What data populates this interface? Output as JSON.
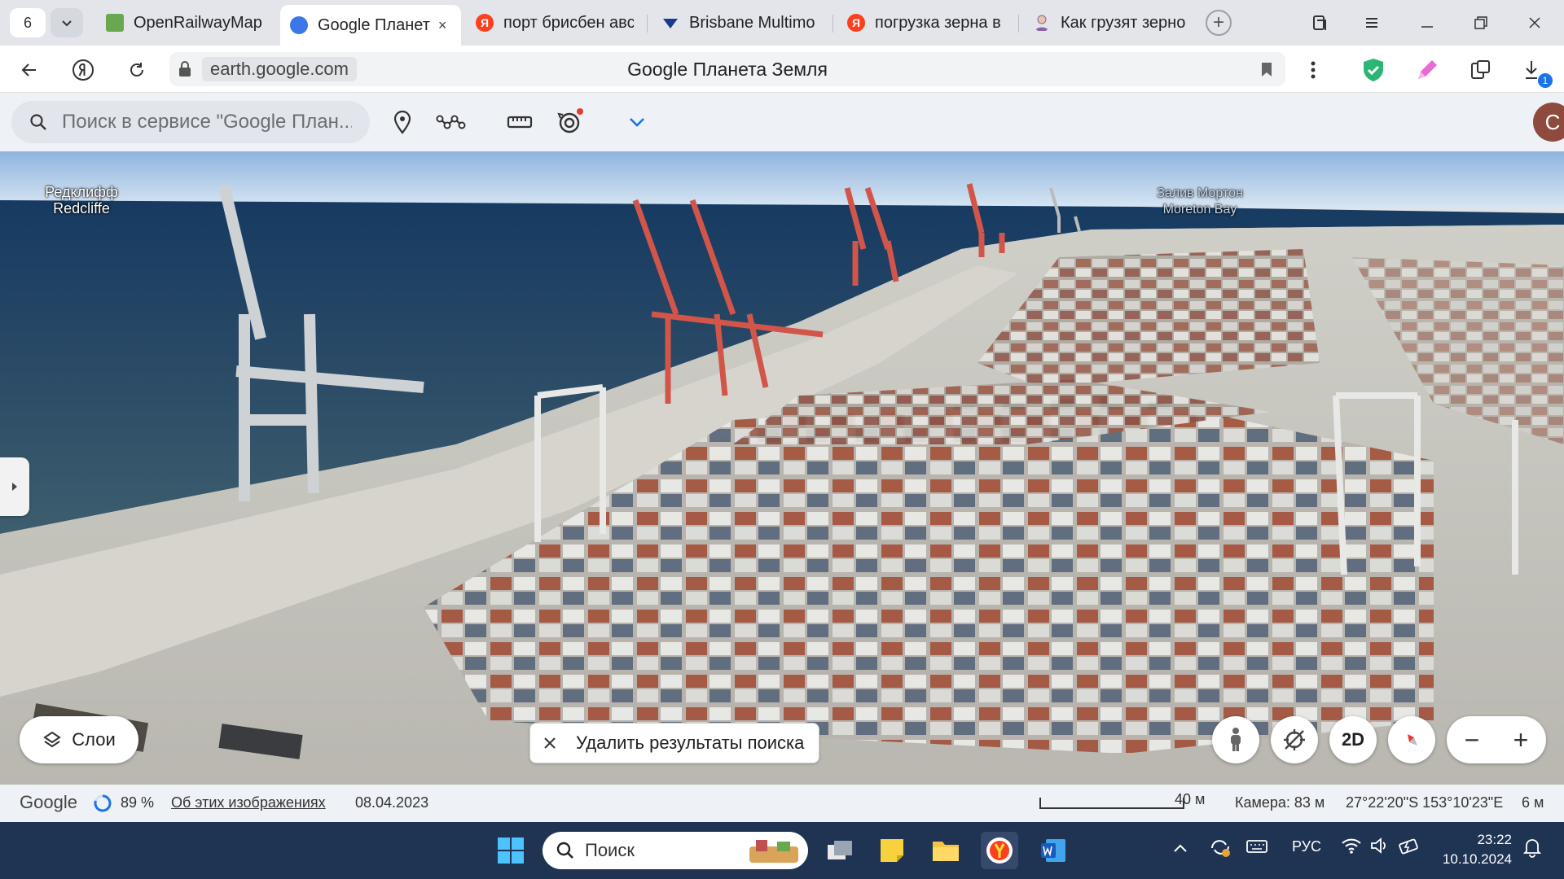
{
  "browser": {
    "tab_count": "6",
    "tabs": [
      {
        "title": "OpenRailwayMap",
        "active": false,
        "favicon_color": "#6aa84f"
      },
      {
        "title": "Google Планет",
        "active": true,
        "favicon_color": "#3b78e7"
      },
      {
        "title": "порт брисбен авс",
        "active": false,
        "favicon_color": "#fc3f1d"
      },
      {
        "title": "Brisbane Multimo",
        "active": false,
        "favicon_color": "#1a3a8a"
      },
      {
        "title": "погрузка зерна в",
        "active": false,
        "favicon_color": "#fc3f1d"
      },
      {
        "title": "Как грузят зерно",
        "active": false,
        "favicon_color": "#8a62a8"
      }
    ],
    "close_tab_glyph": "×",
    "new_tab_glyph": "+",
    "url": "earth.google.com",
    "page_title": "Google Планета Земля",
    "download_badge": "1"
  },
  "earth": {
    "search_placeholder": "Поиск в сервисе \"Google План...",
    "avatar_letter": "C",
    "map_labels": [
      {
        "line1": "Редклифф",
        "line2": "Redcliffe"
      },
      {
        "line1": "Залив Мортон",
        "line2": "Moreton Bay"
      }
    ],
    "layers_label": "Слои",
    "clear_search_label": "Удалить результаты поиска",
    "view_2d_label": "2D",
    "zoom_out": "−",
    "zoom_in": "+"
  },
  "status": {
    "brand": "Google",
    "load_percent": "89 %",
    "about_imagery": "Об этих изображениях",
    "imagery_date": "08.04.2023",
    "scale": "40 м",
    "camera": "Камера: 83 м",
    "coordinates": "27°22'20\"S 153°10'23\"E",
    "elevation": "6 м"
  },
  "taskbar": {
    "search_placeholder": "Поиск",
    "language": "РУС",
    "time": "23:22",
    "date": "10.10.2024"
  },
  "colors": {
    "accent": "#1a73e8",
    "avatar": "#8e4a3c",
    "taskbar": "#1f3353",
    "sea": "#2a4a66",
    "crane_red": "#d2554a"
  }
}
